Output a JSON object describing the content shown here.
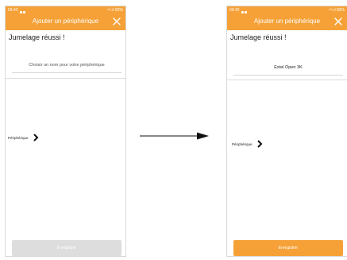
{
  "colors": {
    "accent": "#f5a137",
    "disabled": "#dddddd"
  },
  "before": {
    "status": {
      "time": "09:42",
      "right": "⁶ᴳ.ıl 82%"
    },
    "header": {
      "title": "Ajouter un périphérique",
      "close_icon": "close-icon"
    },
    "heading": "Jumelage réussi !",
    "name_field": {
      "placeholder": "Choisir un nom pour votre périphérique",
      "value": ""
    },
    "device_row": {
      "label": "Périphérique",
      "icon": "chevron-right-icon"
    },
    "save_button": {
      "label": "Enregistrer",
      "enabled": false
    }
  },
  "after": {
    "status": {
      "time": "09:42",
      "right": "⁶ᴳ.ıl 82%"
    },
    "header": {
      "title": "Ajouter un périphérique",
      "close_icon": "close-icon"
    },
    "heading": "Jumelage réussi !",
    "name_field": {
      "placeholder": "",
      "value": "Extel Open 3K"
    },
    "device_row": {
      "label": "Périphérique",
      "icon": "chevron-right-icon"
    },
    "save_button": {
      "label": "Enregistrer",
      "enabled": true
    }
  }
}
